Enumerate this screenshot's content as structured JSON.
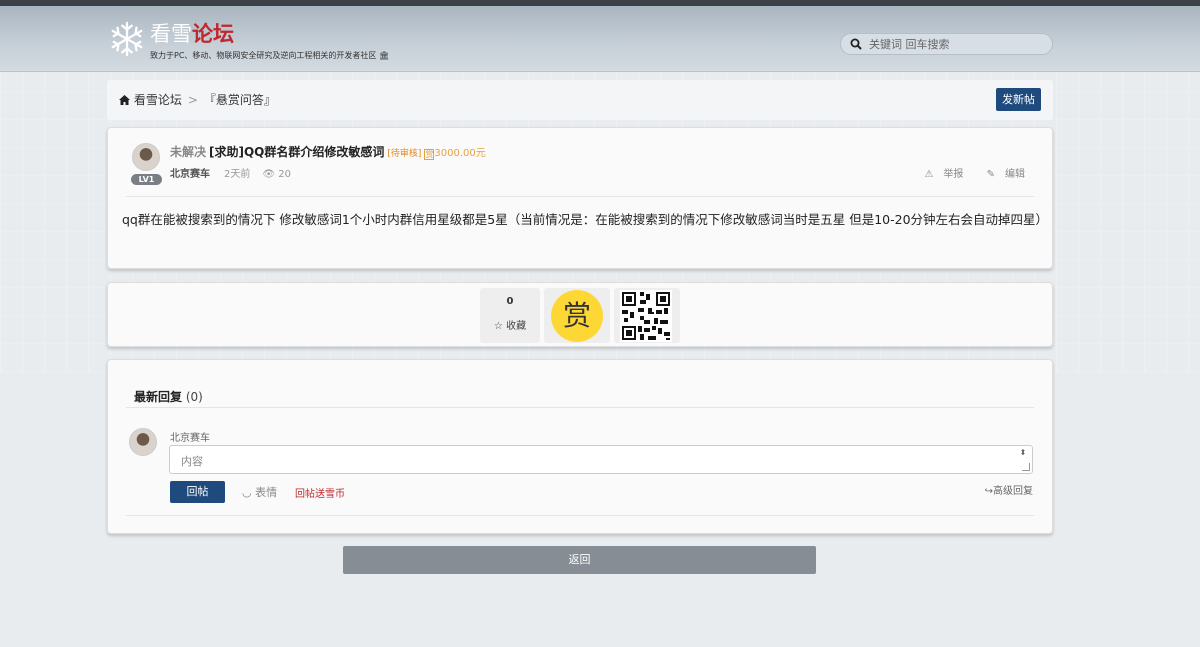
{
  "header": {
    "logo_main": "看雪",
    "logo_accent": "论坛",
    "logo_slogan": "致力于PC、移动、物联网安全研究及逆向工程相关的开发者社区 🏛",
    "search_placeholder": "关键词 回车搜索"
  },
  "breadcrumb": {
    "home": "看雪论坛",
    "separator": ">",
    "section": "『悬赏问答』",
    "new_post_label": "发新帖"
  },
  "post": {
    "level": "LV1",
    "status": "未解决",
    "title": "[求助]QQ群名群介绍修改敏感词",
    "pending": "[待审核]",
    "reward_icon": "赏",
    "reward": "3000.00元",
    "author": "北京赛车",
    "time": "2天前",
    "views": "20",
    "report": "举报",
    "edit": "编辑",
    "content": "qq群在能被搜索到的情况下 修改敏感词1个小时内群信用星级都是5星（当前情况是：在能被搜索到的情况下修改敏感词当时是五星 但是10-20分钟左右会自动掉四星）"
  },
  "actions_bar": {
    "favorite_count": "0",
    "favorite_label": "收藏",
    "tip_label": "赏"
  },
  "reply_section": {
    "title": "最新回复",
    "count": "(0)",
    "user_name": "北京赛车",
    "input_placeholder": "内容",
    "reply_button": "回帖",
    "emoji_label": "表情",
    "coin_label": "回帖送雪币",
    "advanced_label": "高级回复"
  },
  "footer": {
    "back_label": "返回"
  },
  "colors": {
    "primary_button": "#1e4a7e",
    "reward": "#e6a23c",
    "accent_red": "#c0282d",
    "tip_yellow": "#fdd835"
  }
}
